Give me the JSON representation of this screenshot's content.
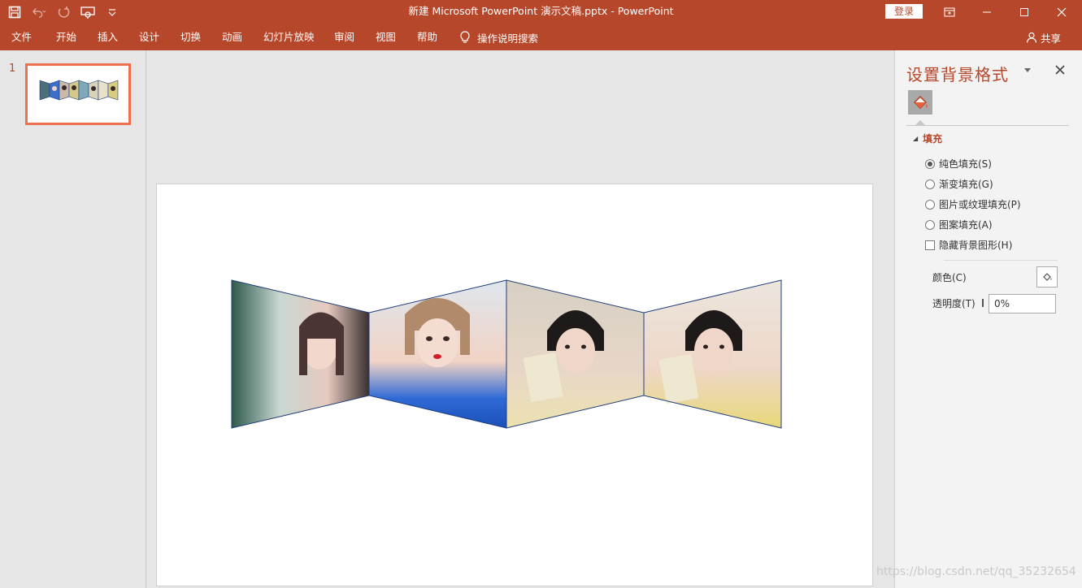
{
  "app": {
    "window_title": "新建 Microsoft PowerPoint 演示文稿.pptx  -  PowerPoint",
    "login_label": "登录"
  },
  "menu": {
    "items": [
      "文件",
      "开始",
      "插入",
      "设计",
      "切换",
      "动画",
      "幻灯片放映",
      "审阅",
      "视图",
      "帮助"
    ],
    "tell_me": "操作说明搜索",
    "share": "共享"
  },
  "thumbnails": {
    "slide_number": "1"
  },
  "format_pane": {
    "title": "设置背景格式",
    "section": "填充",
    "options": [
      {
        "label": "纯色填充(S)",
        "type": "radio",
        "checked": true
      },
      {
        "label": "渐变填充(G)",
        "type": "radio",
        "checked": false
      },
      {
        "label": "图片或纹理填充(P)",
        "type": "radio",
        "checked": false
      },
      {
        "label": "图案填充(A)",
        "type": "radio",
        "checked": false
      },
      {
        "label": "隐藏背景图形(H)",
        "type": "checkbox",
        "checked": false
      }
    ],
    "color_label": "颜色(C)",
    "transparency_label": "透明度(T)",
    "transparency_value": "0%"
  },
  "watermark": "https://blog.csdn.net/qq_35232654",
  "colors": {
    "accent": "#b7472a",
    "thumb_border": "#ee7050"
  }
}
